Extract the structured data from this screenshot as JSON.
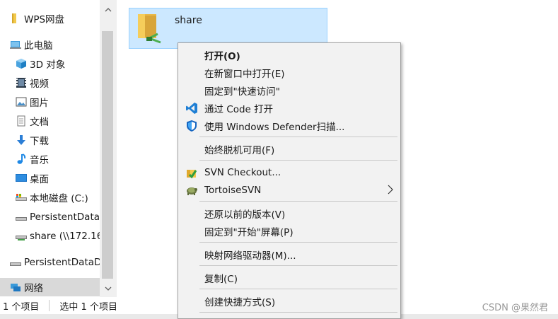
{
  "nav": {
    "items": [
      {
        "label": "WPS网盘",
        "icon": "folder-yellow-icon"
      },
      {
        "label": "此电脑",
        "icon": "computer-icon"
      },
      {
        "label": "3D 对象",
        "icon": "3d-objects-icon"
      },
      {
        "label": "视频",
        "icon": "video-icon"
      },
      {
        "label": "图片",
        "icon": "pictures-icon"
      },
      {
        "label": "文档",
        "icon": "documents-icon"
      },
      {
        "label": "下载",
        "icon": "download-icon"
      },
      {
        "label": "音乐",
        "icon": "music-icon"
      },
      {
        "label": "桌面",
        "icon": "desktop-icon"
      },
      {
        "label": "本地磁盘 (C:)",
        "icon": "local-disk-icon"
      },
      {
        "label": "PersistentDataD",
        "icon": "network-drive-icon"
      },
      {
        "label": "share (\\\\172.16",
        "icon": "network-drive-icon"
      },
      {
        "label": "PersistentDataDi",
        "icon": "drive-icon"
      },
      {
        "label": "网络",
        "icon": "network-icon"
      }
    ]
  },
  "content": {
    "folder": {
      "name": "share",
      "icon": "network-folder-icon"
    }
  },
  "context_menu": {
    "items": [
      {
        "label": "打开(O)",
        "bold": true
      },
      {
        "label": "在新窗口中打开(E)"
      },
      {
        "label": "固定到\"快速访问\""
      },
      {
        "label": "通过 Code 打开",
        "icon": "vscode-icon"
      },
      {
        "label": "使用 Windows Defender扫描...",
        "icon": "defender-shield-icon"
      },
      {
        "label": "始终脱机可用(F)"
      },
      {
        "label": "SVN Checkout...",
        "icon": "svn-checkout-icon"
      },
      {
        "label": "TortoiseSVN",
        "icon": "tortoisesvn-icon",
        "submenu": true
      },
      {
        "label": "还原以前的版本(V)"
      },
      {
        "label": "固定到\"开始\"屏幕(P)"
      },
      {
        "label": "映射网络驱动器(M)..."
      },
      {
        "label": "复制(C)"
      },
      {
        "label": "创建快捷方式(S)"
      }
    ]
  },
  "status": {
    "item_count": "1 个项目",
    "selected_count": "选中 1 个项目"
  },
  "watermark": "CSDN @果然君",
  "colors": {
    "selection_bg": "#cce8ff",
    "selection_border": "#99d1ff",
    "menu_bg": "#f2f2f2",
    "nav_selected": "#d9d9d9"
  }
}
